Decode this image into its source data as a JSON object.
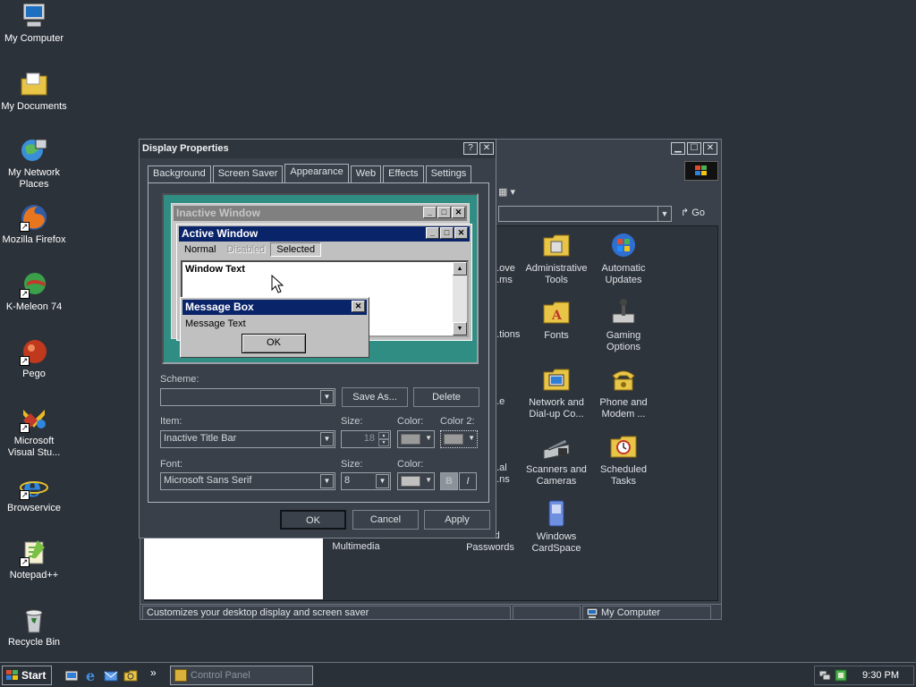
{
  "desktop_icons": [
    {
      "label": "My Computer",
      "icon": "computer-icon"
    },
    {
      "label": "My Documents",
      "icon": "documents-folder-icon"
    },
    {
      "label": "My Network Places",
      "icon": "network-icon"
    },
    {
      "label": "Mozilla Firefox",
      "icon": "firefox-icon"
    },
    {
      "label": "K-Meleon 74",
      "icon": "kmeleon-icon"
    },
    {
      "label": "Pego",
      "icon": "pego-icon"
    },
    {
      "label": "Microsoft Visual Stu...",
      "icon": "visual-studio-icon"
    },
    {
      "label": "Browservice",
      "icon": "ie-icon"
    },
    {
      "label": "Notepad++",
      "icon": "notepadpp-icon"
    },
    {
      "label": "Recycle Bin",
      "icon": "recycle-bin-icon"
    }
  ],
  "control_panel": {
    "go_label": "Go",
    "items": [
      {
        "label": "...ove ...ms"
      },
      {
        "label": "Administrative Tools"
      },
      {
        "label": "Automatic Updates"
      },
      {
        "label": "...tions"
      },
      {
        "label": "Fonts"
      },
      {
        "label": "Gaming Options"
      },
      {
        "label": "...e"
      },
      {
        "label": "Network and Dial-up Co..."
      },
      {
        "label": "Phone and Modem ..."
      },
      {
        "label": "...al ...ns"
      },
      {
        "label": "Scanners and Cameras"
      },
      {
        "label": "Scheduled Tasks"
      },
      {
        "label": "Multimedia"
      },
      {
        "label": "...nd Passwords"
      },
      {
        "label": "Windows CardSpace"
      }
    ],
    "status_text": "Customizes your desktop display and screen saver",
    "status_zone": "My Computer"
  },
  "dialog": {
    "title": "Display Properties",
    "help_label": "?",
    "close_label": "✕",
    "tabs": [
      "Background",
      "Screen Saver",
      "Appearance",
      "Web",
      "Effects",
      "Settings"
    ],
    "active_tab": "Appearance",
    "preview": {
      "inactive_title": "Inactive Window",
      "active_title": "Active Window",
      "menu_normal": "Normal",
      "menu_disabled": "Disabled",
      "menu_selected": "Selected",
      "window_text": "Window Text",
      "msgbox_title": "Message Box",
      "msgbox_text": "Message Text",
      "msgbox_ok": "OK"
    },
    "scheme_label": "Scheme:",
    "scheme_value": "",
    "save_as_label": "Save As...",
    "delete_label": "Delete",
    "item_label": "Item:",
    "item_value": "Inactive Title Bar",
    "item_size_label": "Size:",
    "item_size_value": "18",
    "item_color_label": "Color:",
    "item_color2_label": "Color 2:",
    "font_label": "Font:",
    "font_value": "Microsoft Sans Serif",
    "font_size_label": "Size:",
    "font_size_value": "8",
    "font_color_label": "Color:",
    "bold_label": "B",
    "italic_label": "I",
    "ok_label": "OK",
    "cancel_label": "Cancel",
    "apply_label": "Apply"
  },
  "taskbar": {
    "start_label": "Start",
    "task_label": "Control Panel",
    "more_label": "»",
    "clock": "9:30 PM"
  },
  "colors": {
    "desktop": "#2c323a",
    "active_title": "#0a246a",
    "inactive_title": "#808080",
    "preview_desktop": "#2f8d83"
  }
}
